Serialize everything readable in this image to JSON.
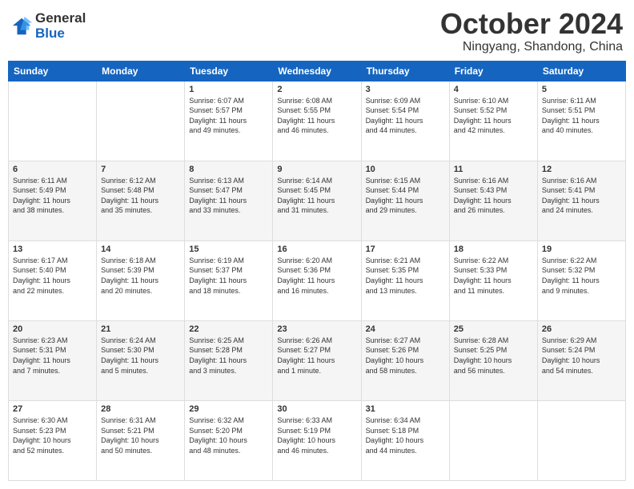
{
  "header": {
    "logo_line1": "General",
    "logo_line2": "Blue",
    "title": "October 2024",
    "subtitle": "Ningyang, Shandong, China"
  },
  "weekdays": [
    "Sunday",
    "Monday",
    "Tuesday",
    "Wednesday",
    "Thursday",
    "Friday",
    "Saturday"
  ],
  "weeks": [
    [
      {
        "day": "",
        "text": ""
      },
      {
        "day": "",
        "text": ""
      },
      {
        "day": "1",
        "text": "Sunrise: 6:07 AM\nSunset: 5:57 PM\nDaylight: 11 hours\nand 49 minutes."
      },
      {
        "day": "2",
        "text": "Sunrise: 6:08 AM\nSunset: 5:55 PM\nDaylight: 11 hours\nand 46 minutes."
      },
      {
        "day": "3",
        "text": "Sunrise: 6:09 AM\nSunset: 5:54 PM\nDaylight: 11 hours\nand 44 minutes."
      },
      {
        "day": "4",
        "text": "Sunrise: 6:10 AM\nSunset: 5:52 PM\nDaylight: 11 hours\nand 42 minutes."
      },
      {
        "day": "5",
        "text": "Sunrise: 6:11 AM\nSunset: 5:51 PM\nDaylight: 11 hours\nand 40 minutes."
      }
    ],
    [
      {
        "day": "6",
        "text": "Sunrise: 6:11 AM\nSunset: 5:49 PM\nDaylight: 11 hours\nand 38 minutes."
      },
      {
        "day": "7",
        "text": "Sunrise: 6:12 AM\nSunset: 5:48 PM\nDaylight: 11 hours\nand 35 minutes."
      },
      {
        "day": "8",
        "text": "Sunrise: 6:13 AM\nSunset: 5:47 PM\nDaylight: 11 hours\nand 33 minutes."
      },
      {
        "day": "9",
        "text": "Sunrise: 6:14 AM\nSunset: 5:45 PM\nDaylight: 11 hours\nand 31 minutes."
      },
      {
        "day": "10",
        "text": "Sunrise: 6:15 AM\nSunset: 5:44 PM\nDaylight: 11 hours\nand 29 minutes."
      },
      {
        "day": "11",
        "text": "Sunrise: 6:16 AM\nSunset: 5:43 PM\nDaylight: 11 hours\nand 26 minutes."
      },
      {
        "day": "12",
        "text": "Sunrise: 6:16 AM\nSunset: 5:41 PM\nDaylight: 11 hours\nand 24 minutes."
      }
    ],
    [
      {
        "day": "13",
        "text": "Sunrise: 6:17 AM\nSunset: 5:40 PM\nDaylight: 11 hours\nand 22 minutes."
      },
      {
        "day": "14",
        "text": "Sunrise: 6:18 AM\nSunset: 5:39 PM\nDaylight: 11 hours\nand 20 minutes."
      },
      {
        "day": "15",
        "text": "Sunrise: 6:19 AM\nSunset: 5:37 PM\nDaylight: 11 hours\nand 18 minutes."
      },
      {
        "day": "16",
        "text": "Sunrise: 6:20 AM\nSunset: 5:36 PM\nDaylight: 11 hours\nand 16 minutes."
      },
      {
        "day": "17",
        "text": "Sunrise: 6:21 AM\nSunset: 5:35 PM\nDaylight: 11 hours\nand 13 minutes."
      },
      {
        "day": "18",
        "text": "Sunrise: 6:22 AM\nSunset: 5:33 PM\nDaylight: 11 hours\nand 11 minutes."
      },
      {
        "day": "19",
        "text": "Sunrise: 6:22 AM\nSunset: 5:32 PM\nDaylight: 11 hours\nand 9 minutes."
      }
    ],
    [
      {
        "day": "20",
        "text": "Sunrise: 6:23 AM\nSunset: 5:31 PM\nDaylight: 11 hours\nand 7 minutes."
      },
      {
        "day": "21",
        "text": "Sunrise: 6:24 AM\nSunset: 5:30 PM\nDaylight: 11 hours\nand 5 minutes."
      },
      {
        "day": "22",
        "text": "Sunrise: 6:25 AM\nSunset: 5:28 PM\nDaylight: 11 hours\nand 3 minutes."
      },
      {
        "day": "23",
        "text": "Sunrise: 6:26 AM\nSunset: 5:27 PM\nDaylight: 11 hours\nand 1 minute."
      },
      {
        "day": "24",
        "text": "Sunrise: 6:27 AM\nSunset: 5:26 PM\nDaylight: 10 hours\nand 58 minutes."
      },
      {
        "day": "25",
        "text": "Sunrise: 6:28 AM\nSunset: 5:25 PM\nDaylight: 10 hours\nand 56 minutes."
      },
      {
        "day": "26",
        "text": "Sunrise: 6:29 AM\nSunset: 5:24 PM\nDaylight: 10 hours\nand 54 minutes."
      }
    ],
    [
      {
        "day": "27",
        "text": "Sunrise: 6:30 AM\nSunset: 5:23 PM\nDaylight: 10 hours\nand 52 minutes."
      },
      {
        "day": "28",
        "text": "Sunrise: 6:31 AM\nSunset: 5:21 PM\nDaylight: 10 hours\nand 50 minutes."
      },
      {
        "day": "29",
        "text": "Sunrise: 6:32 AM\nSunset: 5:20 PM\nDaylight: 10 hours\nand 48 minutes."
      },
      {
        "day": "30",
        "text": "Sunrise: 6:33 AM\nSunset: 5:19 PM\nDaylight: 10 hours\nand 46 minutes."
      },
      {
        "day": "31",
        "text": "Sunrise: 6:34 AM\nSunset: 5:18 PM\nDaylight: 10 hours\nand 44 minutes."
      },
      {
        "day": "",
        "text": ""
      },
      {
        "day": "",
        "text": ""
      }
    ]
  ]
}
